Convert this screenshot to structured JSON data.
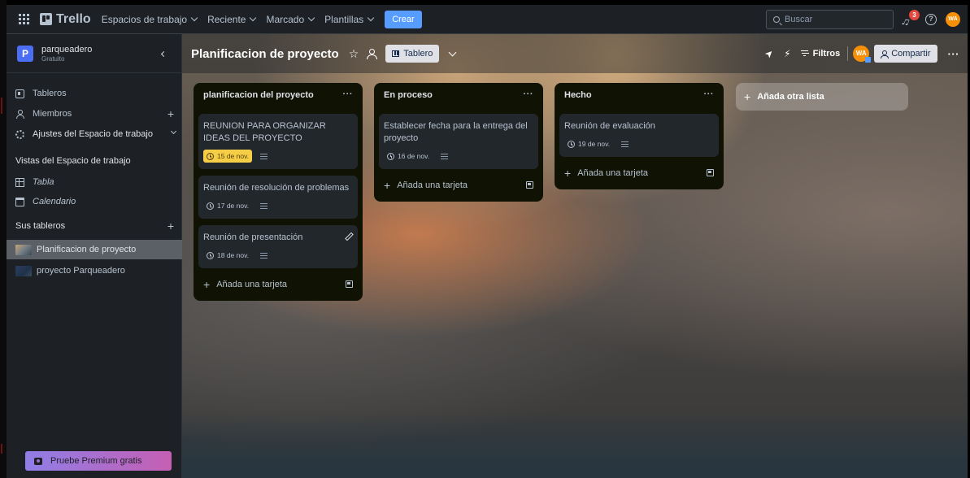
{
  "topbar": {
    "app_name": "Trello",
    "nav": [
      {
        "label": "Espacios de trabajo"
      },
      {
        "label": "Reciente"
      },
      {
        "label": "Marcado"
      },
      {
        "label": "Plantillas"
      }
    ],
    "create_label": "Crear",
    "search_placeholder": "Buscar",
    "notification_count": "3",
    "help_label": "?",
    "user_initials": "WA",
    "accent_color": "#579dff"
  },
  "sidebar": {
    "workspace_initial": "P",
    "workspace_name": "parqueadero",
    "workspace_plan": "Gratuito",
    "items": [
      {
        "label": "Tableros",
        "icon": "board-icon"
      },
      {
        "label": "Miembros",
        "icon": "members-icon"
      },
      {
        "label": "Ajustes del Espacio de trabajo",
        "icon": "settings-icon"
      }
    ],
    "views_heading": "Vistas del Espacio de trabajo",
    "views": [
      {
        "label": "Tabla",
        "icon": "table-icon"
      },
      {
        "label": "Calendario",
        "icon": "calendar-icon"
      }
    ],
    "boards_heading": "Sus tableros",
    "boards": [
      {
        "label": "Planificacion de proyecto",
        "active": true
      },
      {
        "label": "proyecto Parqueadero",
        "active": false
      }
    ],
    "premium_label": "Pruebe Premium gratis"
  },
  "board": {
    "title": "Planificacion de proyecto",
    "view_label": "Tablero",
    "filters_label": "Filtros",
    "member_initials": "WA",
    "share_label": "Compartir",
    "add_list_label": "Añada otra lista",
    "lists": [
      {
        "title": "planificacion del proyecto",
        "cards": [
          {
            "title": "REUNION PARA ORGANIZAR IDEAS DEL PROYECTO",
            "due": "15 de nov.",
            "due_warn": true
          },
          {
            "title": "Reunión de resolución de problemas",
            "due": "17 de nov.",
            "due_warn": false
          },
          {
            "title": "Reunión de presentación",
            "due": "18 de nov.",
            "due_warn": false
          }
        ],
        "add_card_label": "Añada una tarjeta"
      },
      {
        "title": "En proceso",
        "cards": [
          {
            "title": "Establecer fecha para la entrega del proyecto",
            "due": "16 de nov.",
            "due_warn": false
          }
        ],
        "add_card_label": "Añada una tarjeta"
      },
      {
        "title": "Hecho",
        "cards": [
          {
            "title": "Reunión de evaluación",
            "due": "19 de nov.",
            "due_warn": false
          }
        ],
        "add_card_label": "Añada una tarjeta"
      }
    ],
    "more_label": "···"
  }
}
